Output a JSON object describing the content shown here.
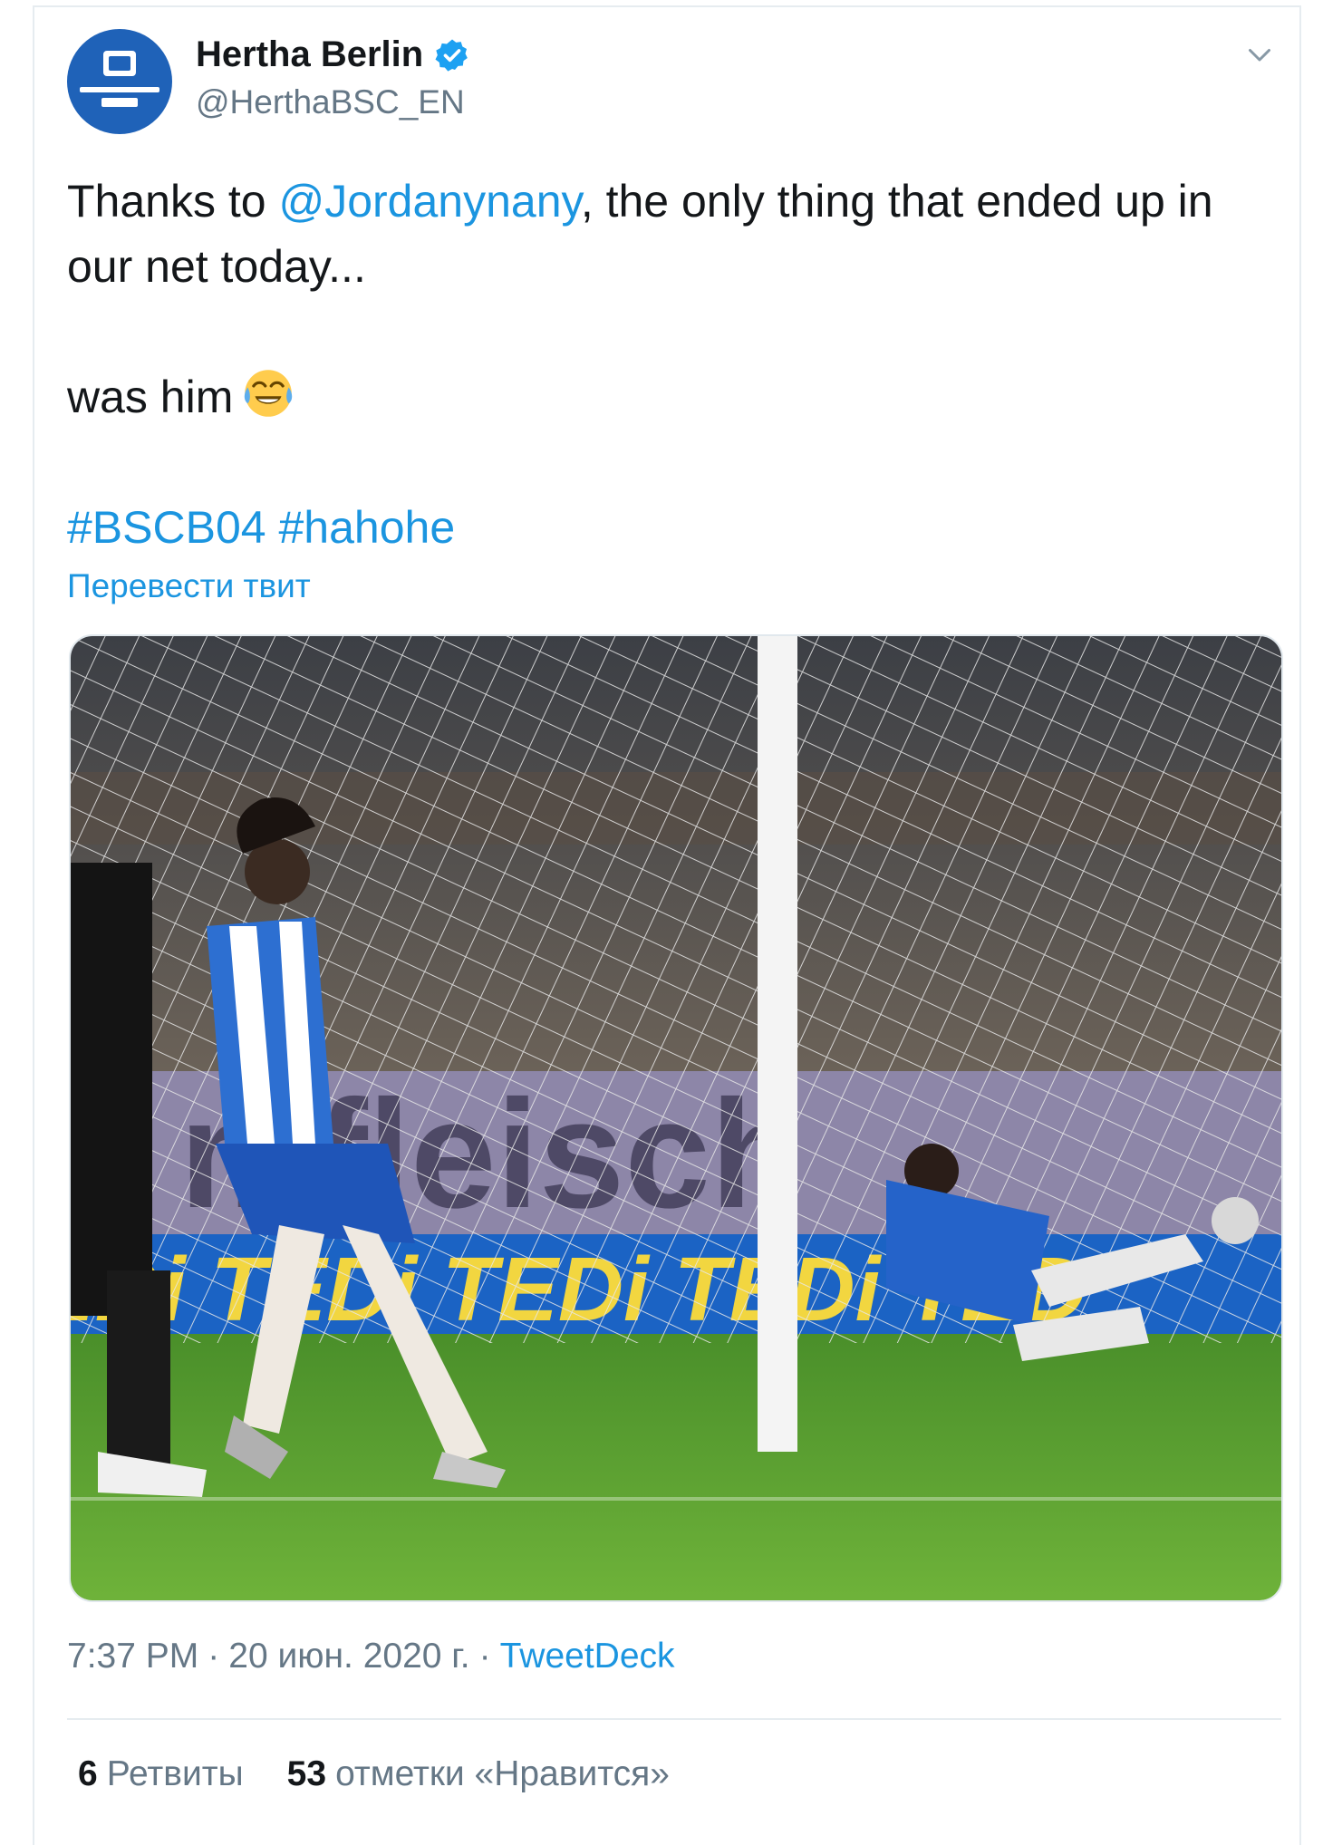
{
  "tweet": {
    "author": {
      "display_name": "Hertha Berlin",
      "handle": "@HerthaBSC_EN",
      "verified": true
    },
    "text": {
      "line1_prefix": "Thanks to ",
      "mention": "@Jordanynany",
      "line1_suffix": ", the only thing that ended up in our net today...",
      "line2": "was him",
      "emoji": "face-with-tears-of-joy",
      "hashtag1": "#BSCB04",
      "hashtag2": "#hahohe"
    },
    "translate_label": "Перевести твит",
    "media": {
      "description_icon": "photo"
    },
    "meta": {
      "time": "7:37 PM",
      "separator": "·",
      "date": "20 июн. 2020 г.",
      "separator2": "·",
      "source": "TweetDeck"
    },
    "stats": {
      "retweets_count": "6",
      "retweets_label": "Ретвиты",
      "likes_count": "53",
      "likes_label": "отметки «Нравится»"
    }
  },
  "colors": {
    "link": "#1b95e0",
    "text": "#14171a",
    "secondary": "#657786",
    "verified": "#1da1f2",
    "avatar_bg": "#1f62b8"
  }
}
